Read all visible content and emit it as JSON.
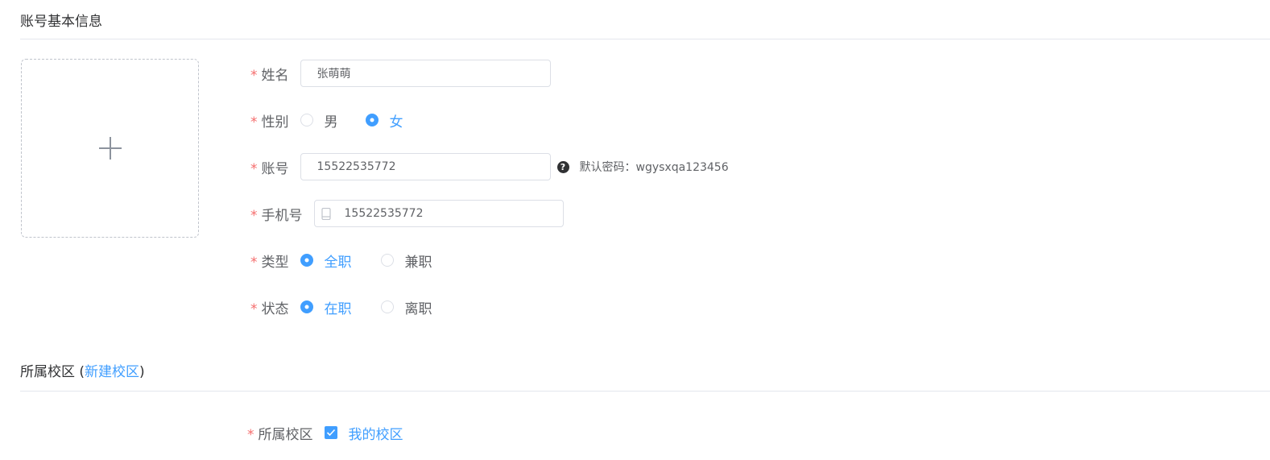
{
  "sections": {
    "basic_info_title": "账号基本信息",
    "campus_title": "所属校区",
    "campus_paren_open": " (",
    "campus_paren_close": ")",
    "new_campus_link": "新建校区"
  },
  "form": {
    "required_mark": "*",
    "name": {
      "label": "姓名",
      "value": "张萌萌"
    },
    "gender": {
      "label": "性别",
      "options": [
        "男",
        "女"
      ],
      "selected": "女"
    },
    "account": {
      "label": "账号",
      "value": "15522535772",
      "help_icon": "question-circle-icon",
      "help_text": "默认密码：wgysxqa123456"
    },
    "phone": {
      "label": "手机号",
      "value": "15522535772",
      "icon": "mobile-phone-icon"
    },
    "type": {
      "label": "类型",
      "options": [
        "全职",
        "兼职"
      ],
      "selected": "全职"
    },
    "status": {
      "label": "状态",
      "options": [
        "在职",
        "离职"
      ],
      "selected": "在职"
    },
    "campus": {
      "label": "所属校区",
      "checkbox_label": "我的校区",
      "checked": true
    }
  },
  "uploader": {
    "icon": "plus-icon"
  },
  "colors": {
    "primary": "#409eff",
    "required": "#f56c6c",
    "border": "#dcdfe6"
  }
}
